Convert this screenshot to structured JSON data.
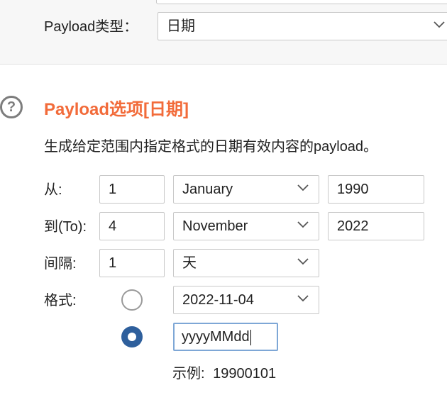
{
  "payload_type": {
    "label": "Payload类型：",
    "value": "日期"
  },
  "section": {
    "title": "Payload选项[日期]",
    "description": "生成给定范围内指定格式的日期有效内容的payload。"
  },
  "from": {
    "label": "从:",
    "day": "1",
    "month": "January",
    "year": "1990"
  },
  "to": {
    "label": "到(To):",
    "day": "4",
    "month": "November",
    "year": "2022"
  },
  "interval": {
    "label": "间隔:",
    "value": "1",
    "unit": "天"
  },
  "format": {
    "label": "格式:",
    "preset_value": "2022-11-04",
    "custom_value": "yyyyMMdd",
    "selected": "custom"
  },
  "example": {
    "label": "示例:",
    "value": "19900101"
  },
  "colors": {
    "title": "#f26b3a",
    "radio_selected": "#2e5f9c",
    "focus_border": "#7ea7d6"
  }
}
